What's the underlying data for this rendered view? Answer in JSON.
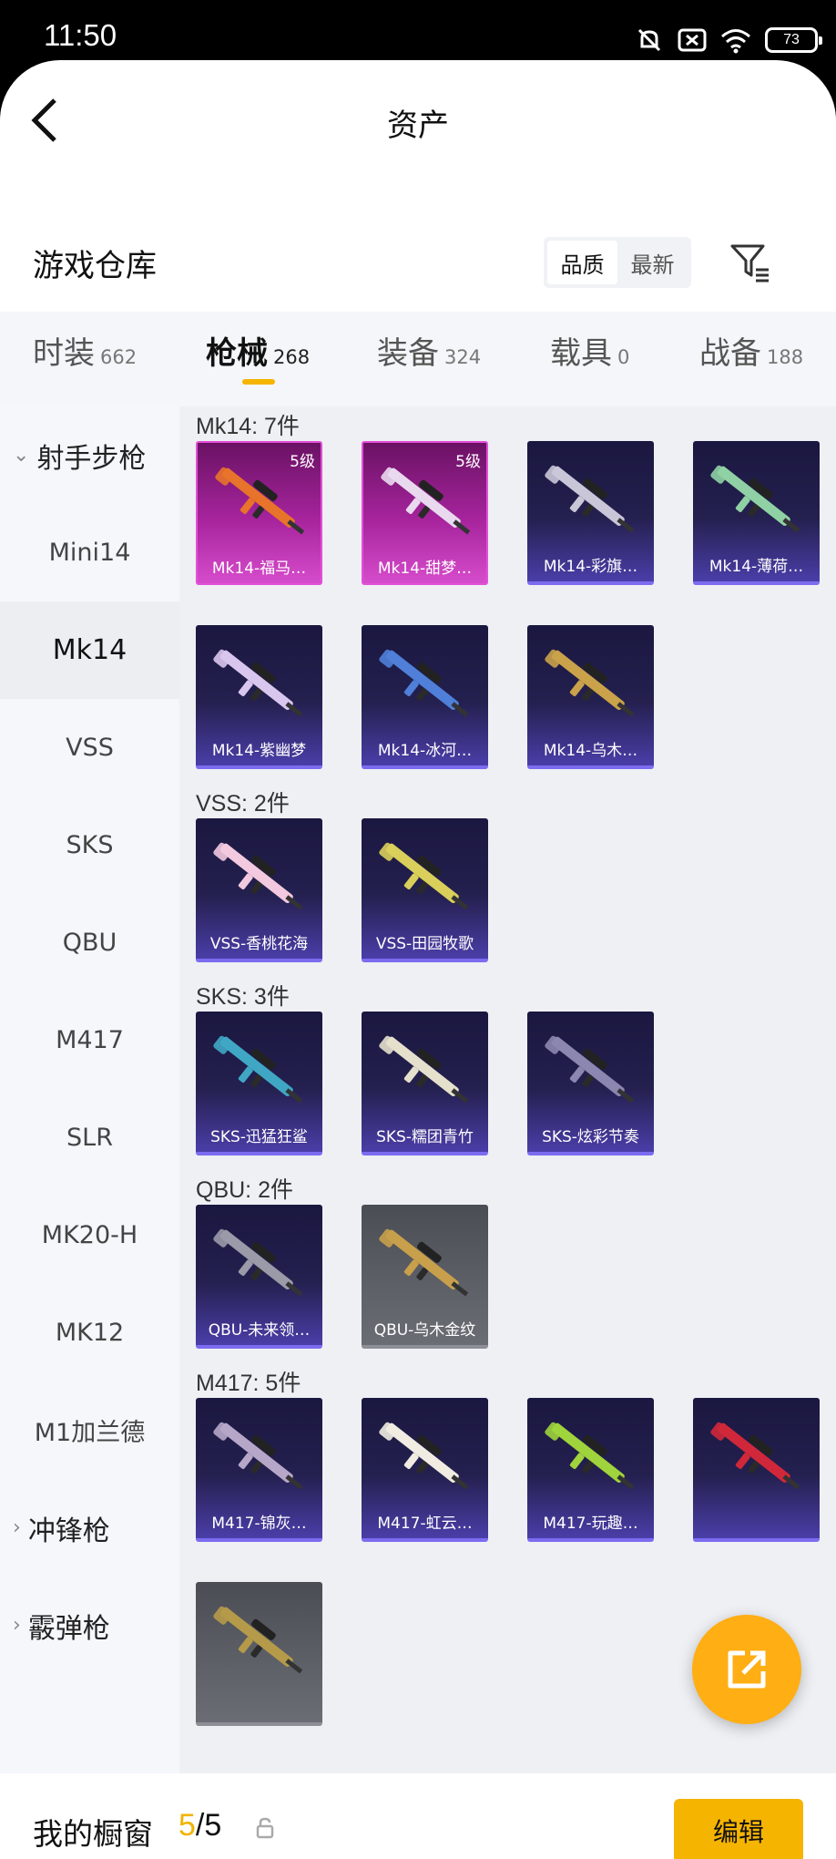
{
  "status": {
    "time": "11:50",
    "battery": "73"
  },
  "header": {
    "title": "资产"
  },
  "warehouse": {
    "title": "游戏仓库",
    "sort_options": [
      "品质",
      "最新"
    ],
    "sort_active": "品质"
  },
  "categories": [
    {
      "name": "时装",
      "count": "662"
    },
    {
      "name": "枪械",
      "count": "268",
      "active": true
    },
    {
      "name": "装备",
      "count": "324"
    },
    {
      "name": "载具",
      "count": "0"
    },
    {
      "name": "战备",
      "count": "188"
    }
  ],
  "sidebar": {
    "group_open": "射手步枪",
    "items": [
      "Mini14",
      "Mk14",
      "VSS",
      "SKS",
      "QBU",
      "M417",
      "SLR",
      "MK20-H",
      "MK12",
      "M1加兰德"
    ],
    "active_item": "Mk14",
    "group_closed_1": "冲锋枪",
    "group_closed_2": "霰弹枪"
  },
  "sections": [
    {
      "label": "Mk14: 7件",
      "items": [
        {
          "name": "Mk14-福马…",
          "level": "5级",
          "rarity": "pink",
          "color": "#e8732a"
        },
        {
          "name": "Mk14-甜梦…",
          "level": "5级",
          "rarity": "pink",
          "color": "#e9d9ef"
        },
        {
          "name": "Mk14-彩旗…",
          "rarity": "purple",
          "color": "#c9c6d8"
        },
        {
          "name": "Mk14-薄荷…",
          "rarity": "purple",
          "color": "#8fd1a4"
        },
        {
          "name": "Mk14-紫幽梦",
          "rarity": "purple",
          "color": "#d9c6ee"
        },
        {
          "name": "Mk14-冰河…",
          "rarity": "purple",
          "color": "#4f7fd8"
        },
        {
          "name": "Mk14-乌木…",
          "rarity": "purple",
          "color": "#c9a24a"
        }
      ]
    },
    {
      "label": "VSS: 2件",
      "items": [
        {
          "name": "VSS-香桃花海",
          "rarity": "purple",
          "color": "#f2c9de"
        },
        {
          "name": "VSS-田园牧歌",
          "rarity": "purple",
          "color": "#d9cf5a"
        }
      ]
    },
    {
      "label": "SKS: 3件",
      "items": [
        {
          "name": "SKS-迅猛狂鲨",
          "rarity": "purple",
          "color": "#3fa7c4"
        },
        {
          "name": "SKS-糯团青竹",
          "rarity": "purple",
          "color": "#e4e0cc"
        },
        {
          "name": "SKS-炫彩节奏",
          "rarity": "purple",
          "color": "#8c87b0"
        }
      ]
    },
    {
      "label": "QBU: 2件",
      "items": [
        {
          "name": "QBU-未来领…",
          "rarity": "purple",
          "color": "#9a9aa8"
        },
        {
          "name": "QBU-乌木金纹",
          "rarity": "grey",
          "color": "#c8a04b"
        }
      ]
    },
    {
      "label": "M417: 5件",
      "items": [
        {
          "name": "M417-锦灰…",
          "rarity": "purple",
          "color": "#b6a7c9"
        },
        {
          "name": "M417-虹云…",
          "rarity": "purple",
          "color": "#f0ece2"
        },
        {
          "name": "M417-玩趣…",
          "rarity": "purple",
          "color": "#9fd43c"
        },
        {
          "name": "",
          "rarity": "purple",
          "color": "#d0283a"
        },
        {
          "name": "",
          "rarity": "grey",
          "color": "#b59a4a"
        }
      ]
    }
  ],
  "showcase": {
    "label": "我的橱窗",
    "current": "5",
    "total": "/5",
    "edit_label": "编辑"
  },
  "colors": {
    "accent": "#f5b400",
    "fab": "#ffae14"
  },
  "icons": [
    "back-arrow-icon",
    "filter-icon",
    "share-icon",
    "lock-icon",
    "mute-icon",
    "sim-off-icon",
    "wifi-icon",
    "battery-icon"
  ]
}
